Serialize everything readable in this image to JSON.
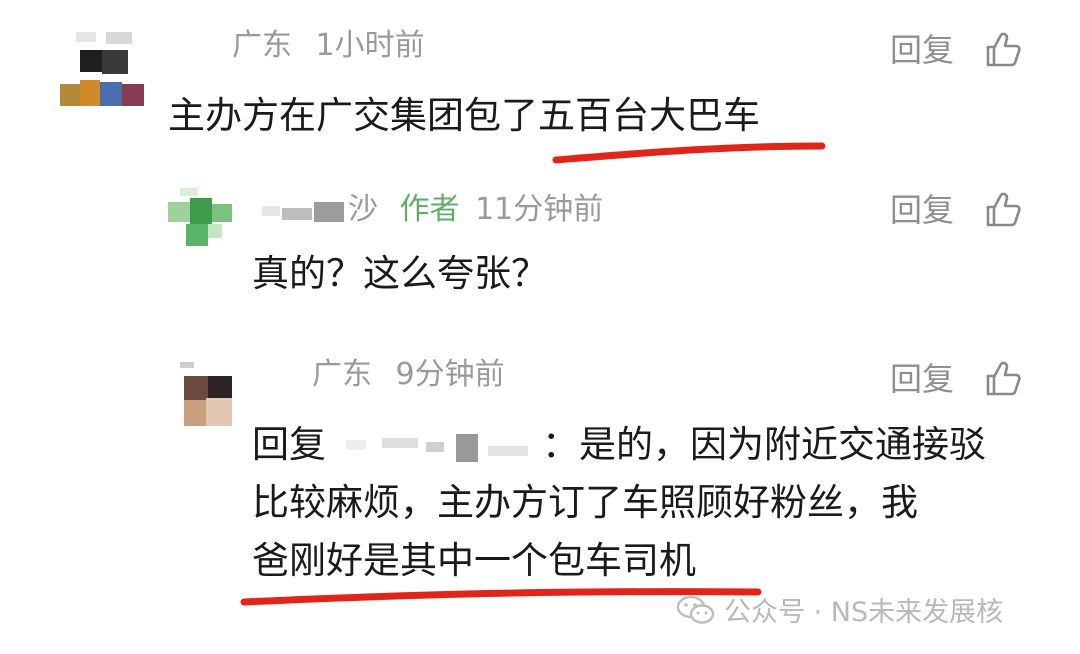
{
  "comments": [
    {
      "location": "广东",
      "time": "1小时前",
      "reply_label": "回复",
      "text_plain": "主办方在广交集团包了",
      "text_highlight": "五百台大巴车"
    },
    {
      "name_partial": "沙",
      "author_tag": "作者",
      "time": "11分钟前",
      "reply_label": "回复",
      "text": "真的？这么夸张？"
    },
    {
      "location": "广东",
      "time": "9分钟前",
      "reply_label": "回复",
      "reply_prefix": "回复",
      "line1_rest": "：是的，因为附近交通接驳",
      "line2": "比较麻烦，主办方订了车照顾好粉丝，我",
      "line3": "爸刚好是其中一个包车司机"
    }
  ],
  "watermark": {
    "text": "公众号 · NS未来发展核"
  },
  "colors": {
    "underline": "#e0251b",
    "author_tag": "#5fae6a",
    "meta": "#9a9a9a"
  },
  "icons": {
    "like": "thumbs-up-icon",
    "watermark": "wechat-icon"
  }
}
